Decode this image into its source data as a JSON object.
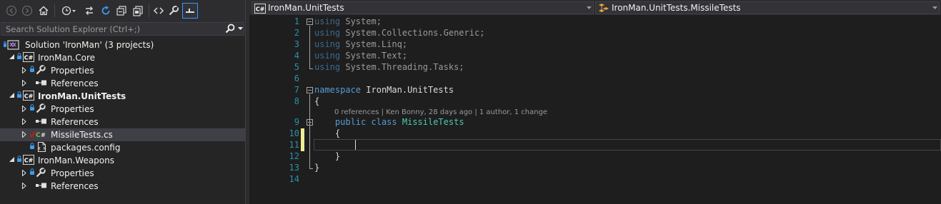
{
  "toolbar": {
    "buttons": [
      {
        "name": "back-icon"
      },
      {
        "name": "forward-icon"
      },
      {
        "name": "home-icon"
      },
      {
        "name": "pending-changes-filter-icon"
      },
      {
        "name": "sync-with-active-document-icon"
      },
      {
        "name": "refresh-icon"
      },
      {
        "name": "collapse-all-icon"
      },
      {
        "name": "show-all-files-icon"
      },
      {
        "name": "view-code-icon"
      },
      {
        "name": "properties-icon"
      },
      {
        "name": "preview-selected-items-icon"
      }
    ]
  },
  "search": {
    "placeholder": "Search Solution Explorer (Ctrl+;)"
  },
  "tree": {
    "solution": "Solution 'IronMan' (3 projects)",
    "projects": [
      {
        "name": "IronMan.Core",
        "bold": false,
        "children": [
          "Properties",
          "References"
        ]
      },
      {
        "name": "IronMan.UnitTests",
        "bold": true,
        "children": [
          "Properties",
          "References",
          "MissileTests.cs",
          "packages.config"
        ]
      },
      {
        "name": "IronMan.Weapons",
        "bold": false,
        "children": [
          "Properties",
          "References"
        ]
      }
    ],
    "selected_item": "MissileTests.cs"
  },
  "editor": {
    "project_combo": "IronMan.UnitTests",
    "type_combo": "IronMan.UnitTests.MissileTests",
    "line_numbers": [
      "1",
      "2",
      "3",
      "4",
      "5",
      "6",
      "7",
      "8",
      "9",
      "10",
      "11",
      "12",
      "13",
      "14"
    ],
    "code": {
      "using_kw": "using",
      "usings": [
        "System;",
        "System.Collections.Generic;",
        "System.Linq;",
        "System.Text;",
        "System.Threading.Tasks;"
      ],
      "namespace_kw": "namespace",
      "namespace_name": "IronMan.UnitTests",
      "open_brace": "{",
      "close_brace": "}",
      "codelens": "0 references | Ken Bonny, 28 days ago | 1 author, 1 change",
      "public_kw": "public",
      "class_kw": "class",
      "class_name": "MissileTests"
    }
  },
  "colors": {
    "keyword": "#569cd6",
    "type": "#4ec9b0",
    "line_number": "#2b91af",
    "change_marker": "#efef91",
    "selection_accent": "#3399ff"
  }
}
